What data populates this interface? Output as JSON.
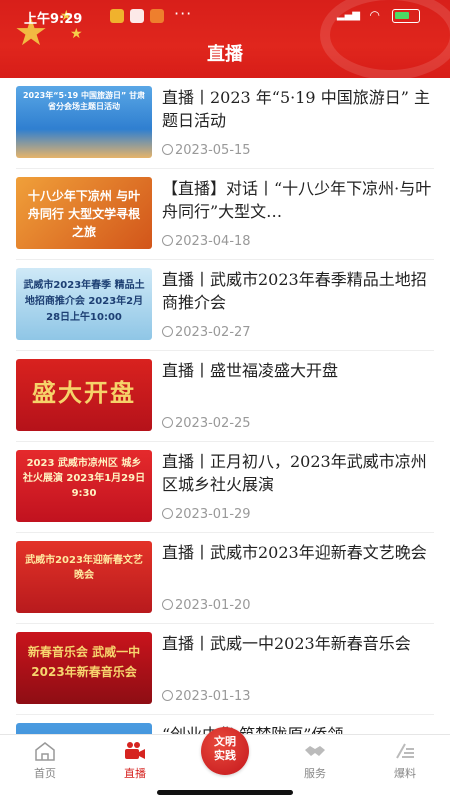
{
  "status_bar": {
    "time": "上午9:29",
    "battery": "47"
  },
  "header": {
    "title": "直播"
  },
  "items": [
    {
      "title": "直播丨2023 年“5·19 中国旅游日” 主题日活动",
      "date": "2023-05-15",
      "thumb_text": "2023年“5·19 中国旅游日” 甘肃省分会场主题日活动",
      "thumb_bg": "#3c8fd8"
    },
    {
      "title": "【直播】对话丨“十八少年下凉州·与叶舟同行”大型文…",
      "date": "2023-04-18",
      "thumb_text": "十八少年下凉州 与叶舟同行 大型文学寻根之旅",
      "thumb_bg": "#d9641e"
    },
    {
      "title": "直播丨武威市2023年春季精品土地招商推介会",
      "date": "2023-02-27",
      "thumb_text": "武威市2023年春季 精品土地招商推介会 2023年2月28日上午10:00",
      "thumb_bg": "#9fd1ea"
    },
    {
      "title": "直播丨盛世福凌盛大开盘",
      "date": "2023-02-25",
      "thumb_text": "盛大开盘",
      "thumb_bg": "#c81a1e"
    },
    {
      "title": "直播丨正月初八，2023年武威市凉州区城乡社火展演",
      "date": "2023-01-29",
      "thumb_text": "2023 武威市凉州区 城乡社火展演 2023年1月29日 9:30",
      "thumb_bg": "#d51d25"
    },
    {
      "title": "直播丨武威市2023年迎新春文艺晚会",
      "date": "2023-01-20",
      "thumb_text": "武威市2023年迎新春文艺晚会",
      "thumb_bg": "#cf1f22"
    },
    {
      "title": "直播丨武威一中2023年新春音乐会",
      "date": "2023-01-13",
      "thumb_text": "新春音乐会 武威一中2023年新春音乐会",
      "thumb_bg": "#b3141b"
    },
    {
      "title": "“创业中华·筑梦陇原”侨领",
      "date": "",
      "thumb_text": "",
      "thumb_bg": "#2f7fd0"
    }
  ],
  "tabbar": {
    "tabs": [
      {
        "label": "首页",
        "icon": "home-icon"
      },
      {
        "label": "直播",
        "icon": "video-camera-icon"
      },
      {
        "label": "文明实践",
        "icon": "civilization-badge-icon"
      },
      {
        "label": "服务",
        "icon": "handshake-icon"
      },
      {
        "label": "爆料",
        "icon": "edit-icon"
      }
    ]
  },
  "colors": {
    "accent": "#d62420",
    "header": "#d81f1a"
  }
}
